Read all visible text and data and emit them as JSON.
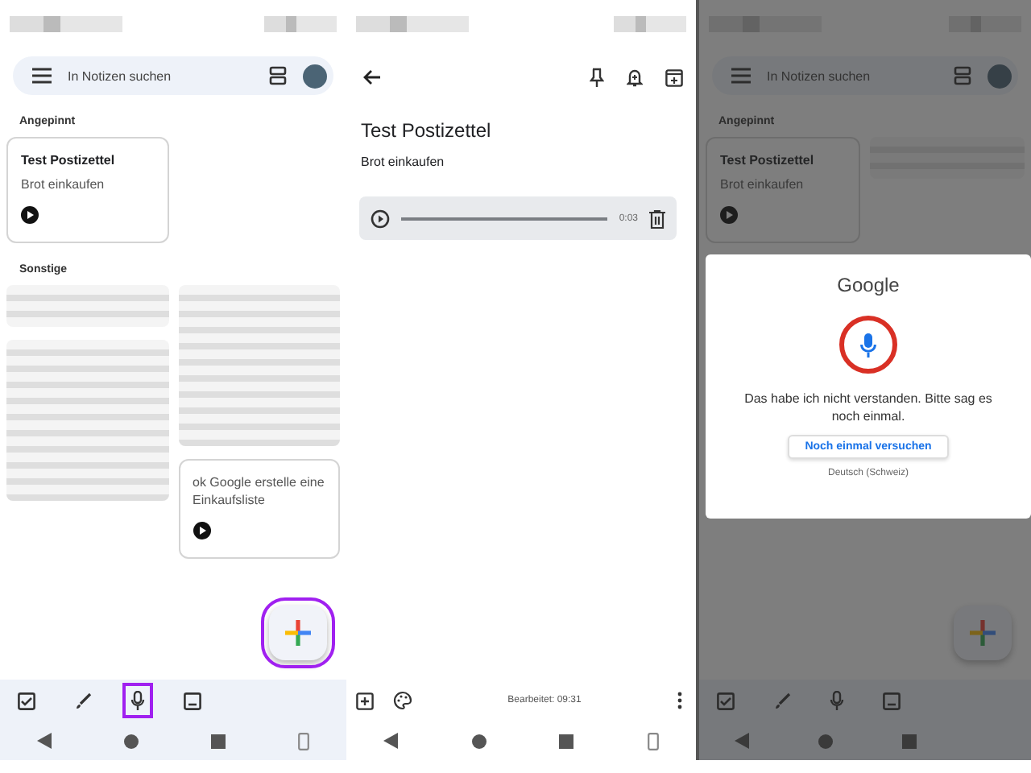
{
  "panels": [
    {
      "kind": "list",
      "search": {
        "placeholder": "In Notizen suchen"
      },
      "sections": [
        {
          "heading": "Angepinnt",
          "columns": [
            [
              {
                "kind": "note",
                "title": "Test Postizettel",
                "body": "Brot einkaufen",
                "audio": true
              }
            ],
            []
          ]
        },
        {
          "heading": "Sonstige",
          "columns": [
            [
              {
                "kind": "blurred-short"
              },
              {
                "kind": "blurred-tall"
              }
            ],
            [
              {
                "kind": "blurred-tall"
              },
              {
                "kind": "note",
                "body": "ok Google erstelle eine Einkaufsliste",
                "audio": true
              }
            ]
          ]
        }
      ],
      "toolbar": [
        {
          "kind": "checkbox",
          "highlighted": false
        },
        {
          "kind": "brush",
          "highlighted": false
        },
        {
          "kind": "mic",
          "highlighted": true
        },
        {
          "kind": "image",
          "highlighted": false
        }
      ],
      "fab": {
        "highlighted": true
      },
      "rotate_button": true
    },
    {
      "kind": "editor",
      "title": "Test Postizettel",
      "body": "Brot einkaufen",
      "audio": {
        "reading": "0:03"
      },
      "footer": "Bearbeitet: 09:31",
      "rotate_button": true
    },
    {
      "kind": "list",
      "search": {
        "placeholder": "In Notizen suchen"
      },
      "sections": [
        {
          "heading": "Angepinnt",
          "columns": [
            [
              {
                "kind": "note",
                "title": "Test Postizettel",
                "body": "Brot einkaufen",
                "audio": true
              }
            ],
            [
              {
                "kind": "blurred-short"
              }
            ]
          ]
        }
      ],
      "toolbar": [
        {
          "kind": "checkbox",
          "highlighted": false
        },
        {
          "kind": "brush",
          "highlighted": false
        },
        {
          "kind": "mic",
          "highlighted": false
        },
        {
          "kind": "image",
          "highlighted": false
        }
      ],
      "fab": {
        "highlighted": false
      },
      "rotate_button": false,
      "dialog": {
        "brand": "Google",
        "message": "Das habe ich nicht verstanden. Bitte sag es noch einmal.",
        "button": "Noch einmal versuchen",
        "language": "Deutsch (Schweiz)"
      }
    }
  ]
}
